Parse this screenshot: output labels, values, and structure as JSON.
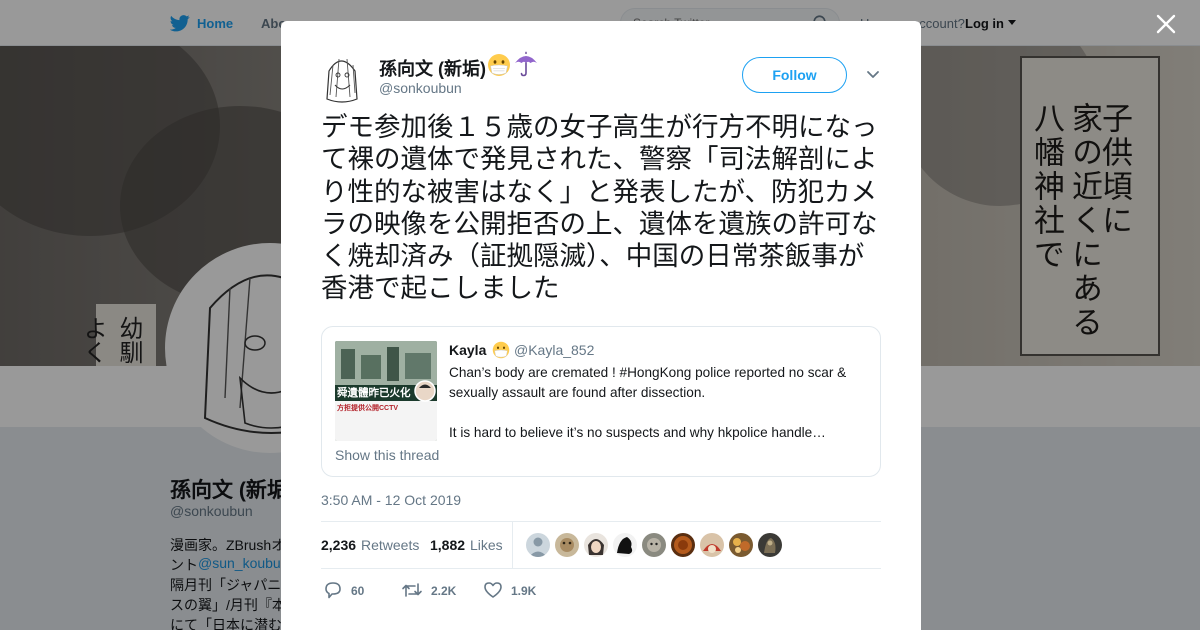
{
  "background": {
    "nav": {
      "home": "Home",
      "about": "Abo"
    },
    "search": {
      "placeholder": "Search Twitter"
    },
    "account": {
      "prompt": "Have an account?",
      "login": "Log in"
    },
    "banner_text": [
      "子供頃に",
      "家の近くにある",
      "八幡神社で"
    ],
    "banner_left_text": [
      "幼馴",
      "よく"
    ],
    "profile": {
      "name": "孫向文 (新垢)",
      "handle": "@sonkoubun",
      "bio_lines": [
        "漫画家。ZBrushオ",
        "ント",
        "@sun_koubun",
        "隔月刊「ジャパニ",
        "スの翼」/月刊『本",
        "にて「日本に潜む"
      ]
    }
  },
  "tweet": {
    "author_name": "孫向文 (新垢)",
    "author_handle": "@sonkoubun",
    "follow_label": "Follow",
    "text": "デモ参加後１５歳の女子高生が行方不明になって裸の遺体で発見された、警察「司法解剖により性的な被害はなく」と発表したが、防犯カメラの映像を公開拒否の上、遺体を遺族の許可なく焼却済み（証拠隠滅）、中国の日常茶飯事が香港で起こしました",
    "quoted": {
      "name": "Kayla",
      "handle": "@Kayla_852",
      "text_line1": "Chan’s body are cremated ! #HongKong police reported no scar & sexually assault are found after dissection.",
      "text_line2": "It is hard to believe it’s no suspects and why hkpolice handle…",
      "show_thread": "Show this thread",
      "thumb_caption": "舜遺體昨已火化",
      "thumb_sub": "方拒提供公開CCTV"
    },
    "timestamp": "3:50 AM - 12 Oct 2019",
    "stats": {
      "retweets_count": "2,236",
      "retweets_label": "Retweets",
      "likes_count": "1,882",
      "likes_label": "Likes"
    },
    "actions": {
      "replies": "60",
      "retweets": "2.2K",
      "likes": "1.9K"
    }
  },
  "colors": {
    "accent": "#1da1f2",
    "text": "#14171a",
    "muted": "#657786",
    "border": "#e6ecf0"
  },
  "icons": [
    "twitter-bird-icon",
    "search-icon",
    "close-icon",
    "chevron-down-icon",
    "reply-icon",
    "retweet-icon",
    "like-icon",
    "mask-emoji-icon",
    "umbrella-emoji-icon"
  ]
}
